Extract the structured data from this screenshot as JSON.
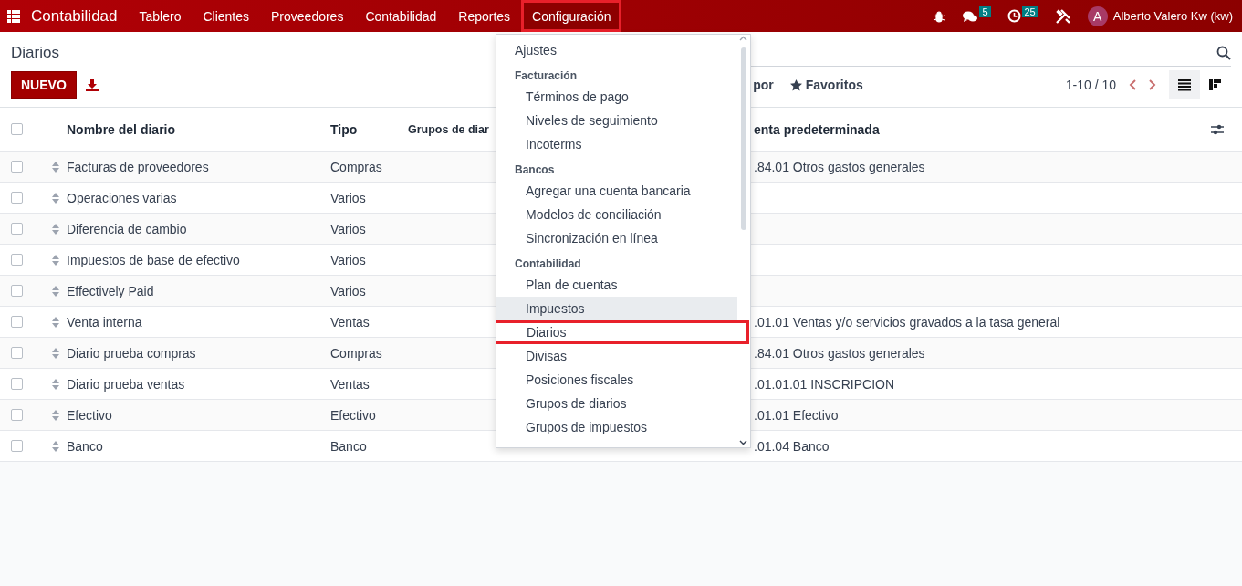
{
  "navbar": {
    "app_name": "Contabilidad",
    "menus": [
      {
        "label": "Tablero",
        "selected": false,
        "highlighted": false
      },
      {
        "label": "Clientes",
        "selected": false,
        "highlighted": false
      },
      {
        "label": "Proveedores",
        "selected": false,
        "highlighted": false
      },
      {
        "label": "Contabilidad",
        "selected": false,
        "highlighted": false
      },
      {
        "label": "Reportes",
        "selected": false,
        "highlighted": false
      },
      {
        "label": "Configuración",
        "selected": true,
        "highlighted": true
      }
    ],
    "messages_count": "5",
    "activities_count": "25",
    "user": {
      "initial": "A",
      "name": "Alberto Valero Kw (kw)"
    }
  },
  "control_panel": {
    "title": "Diarios",
    "new_button": "NUEVO",
    "group_by_partial": "por",
    "favorites": "Favoritos",
    "pager": "1-10 / 10",
    "views": [
      {
        "kind": "list",
        "selected": true
      },
      {
        "kind": "kanban",
        "selected": false
      }
    ]
  },
  "table": {
    "header_checked": false,
    "columns": [
      "Nombre del diario",
      "Tipo",
      "Grupos de diar",
      "enta predeterminada"
    ],
    "rows": [
      {
        "checked": false,
        "name": "Facturas de proveedores",
        "type": "Compras",
        "account": ".84.01 Otros gastos generales"
      },
      {
        "checked": false,
        "name": "Operaciones varias",
        "type": "Varios",
        "account": ""
      },
      {
        "checked": false,
        "name": "Diferencia de cambio",
        "type": "Varios",
        "account": ""
      },
      {
        "checked": false,
        "name": "Impuestos de base de efectivo",
        "type": "Varios",
        "account": ""
      },
      {
        "checked": false,
        "name": "Effectively Paid",
        "type": "Varios",
        "account": ""
      },
      {
        "checked": false,
        "name": "Venta interna",
        "type": "Ventas",
        "account": ".01.01 Ventas y/o servicios gravados a la tasa general"
      },
      {
        "checked": false,
        "name": "Diario prueba compras",
        "type": "Compras",
        "account": ".84.01 Otros gastos generales"
      },
      {
        "checked": false,
        "name": "Diario prueba ventas",
        "type": "Ventas",
        "account": ".01.01.01 INSCRIPCION"
      },
      {
        "checked": false,
        "name": "Efectivo",
        "type": "Efectivo",
        "account": ".01.01 Efectivo"
      },
      {
        "checked": false,
        "name": "Banco",
        "type": "Banco",
        "account": ".01.04 Banco"
      }
    ]
  },
  "dropdown": {
    "items": [
      {
        "kind": "top",
        "label": "Ajustes",
        "hovered": false,
        "highlighted": false
      },
      {
        "kind": "header",
        "label": "Facturación"
      },
      {
        "kind": "sub",
        "label": "Términos de pago",
        "hovered": false,
        "highlighted": false
      },
      {
        "kind": "sub",
        "label": "Niveles de seguimiento",
        "hovered": false,
        "highlighted": false
      },
      {
        "kind": "sub",
        "label": "Incoterms",
        "hovered": false,
        "highlighted": false
      },
      {
        "kind": "header",
        "label": "Bancos"
      },
      {
        "kind": "sub",
        "label": "Agregar una cuenta bancaria",
        "hovered": false,
        "highlighted": false
      },
      {
        "kind": "sub",
        "label": "Modelos de conciliación",
        "hovered": false,
        "highlighted": false
      },
      {
        "kind": "sub",
        "label": "Sincronización en línea",
        "hovered": false,
        "highlighted": false
      },
      {
        "kind": "header",
        "label": "Contabilidad"
      },
      {
        "kind": "sub",
        "label": "Plan de cuentas",
        "hovered": false,
        "highlighted": false
      },
      {
        "kind": "sub",
        "label": "Impuestos",
        "hovered": true,
        "highlighted": false
      },
      {
        "kind": "sub",
        "label": "Diarios",
        "hovered": false,
        "highlighted": true
      },
      {
        "kind": "sub",
        "label": "Divisas",
        "hovered": false,
        "highlighted": false
      },
      {
        "kind": "sub",
        "label": "Posiciones fiscales",
        "hovered": false,
        "highlighted": false
      },
      {
        "kind": "sub",
        "label": "Grupos de diarios",
        "hovered": false,
        "highlighted": false
      },
      {
        "kind": "sub",
        "label": "Grupos de impuestos",
        "hovered": false,
        "highlighted": false
      }
    ]
  }
}
